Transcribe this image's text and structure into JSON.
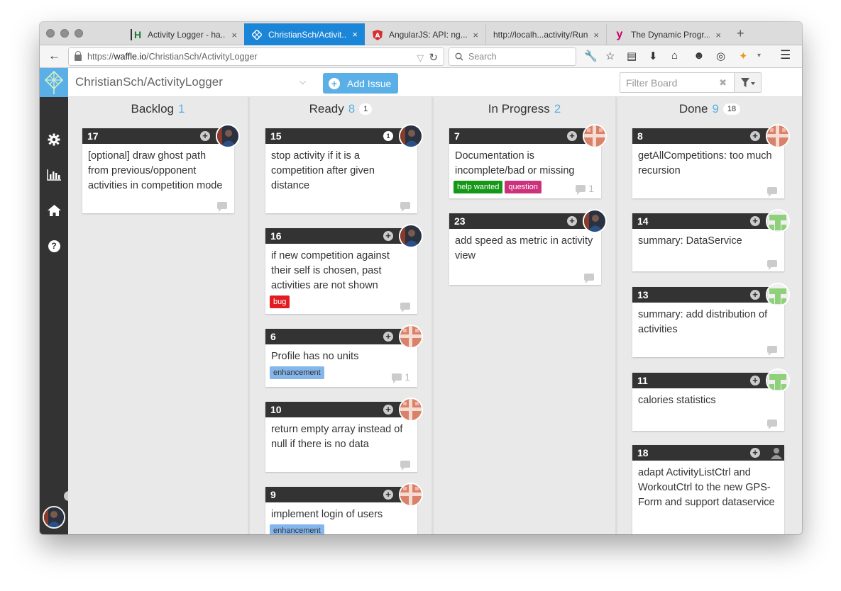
{
  "browser": {
    "tabs": [
      {
        "title": "Activity Logger - ha...",
        "icon": "H",
        "active": false
      },
      {
        "title": "ChristianSch/Activit...",
        "icon": "waffle",
        "active": true
      },
      {
        "title": "AngularJS: API: ng...",
        "icon": "angular",
        "active": false
      },
      {
        "title": "http://localh...activity/Run/",
        "icon": "",
        "active": false
      },
      {
        "title": "The Dynamic Progr...",
        "icon": "y",
        "active": false
      }
    ],
    "close_glyph": "×",
    "new_tab": "+",
    "url_prefix": "https://",
    "url_domain": "waffle.io",
    "url_path": "/ChristianSch/ActivityLogger",
    "search_placeholder": "Search"
  },
  "app": {
    "repo": "ChristianSch/ActivityLogger",
    "add_issue_label": "Add Issue",
    "filter_placeholder": "Filter Board",
    "accent_color": "#5ab0e6"
  },
  "columns": [
    {
      "name": "Backlog",
      "count": "1",
      "pill": ""
    },
    {
      "name": "Ready",
      "count": "8",
      "pill": "1"
    },
    {
      "name": "In Progress",
      "count": "2",
      "pill": ""
    },
    {
      "name": "Done",
      "count": "9",
      "pill": "18"
    }
  ],
  "cards": {
    "c17": {
      "number": "17",
      "title": "[optional] draw ghost path from previous/opponent activities in competition mode",
      "comments": ""
    },
    "c15": {
      "number": "15",
      "badge": "1",
      "title": "stop activity if it is a competition after given distance",
      "comments": ""
    },
    "c16": {
      "number": "16",
      "title": "if new competition against their self is chosen, past activities are not shown",
      "labels": [
        "bug"
      ],
      "comments": ""
    },
    "c6": {
      "number": "6",
      "title": "Profile has no units",
      "labels": [
        "enhancement"
      ],
      "comments": "1"
    },
    "c10": {
      "number": "10",
      "title": "return empty array instead of null if there is no data",
      "comments": ""
    },
    "c9": {
      "number": "9",
      "title": "implement login of users",
      "labels": [
        "enhancement"
      ],
      "comments": ""
    },
    "c7": {
      "number": "7",
      "title": "Documentation is incomplete/bad or missing",
      "labels": [
        "help wanted",
        "question"
      ],
      "comments": "1"
    },
    "c23": {
      "number": "23",
      "title": "add speed as metric in activity view",
      "comments": ""
    },
    "c8": {
      "number": "8",
      "title": "getAllCompetitions: too much recursion",
      "comments": ""
    },
    "c14": {
      "number": "14",
      "title": "summary: DataService",
      "comments": ""
    },
    "c13": {
      "number": "13",
      "title": "summary: add distribution of activities",
      "comments": ""
    },
    "c11": {
      "number": "11",
      "title": "calories statistics",
      "comments": ""
    },
    "c18": {
      "number": "18",
      "title": "adapt ActivityListCtrl and WorkoutCtrl to the new GPS-Form and support dataservice",
      "comments": ""
    }
  },
  "label_colors": {
    "bug": "#e11d21",
    "enhancement": "#84b6eb",
    "help wanted": "#159818",
    "question": "#cc317c"
  }
}
